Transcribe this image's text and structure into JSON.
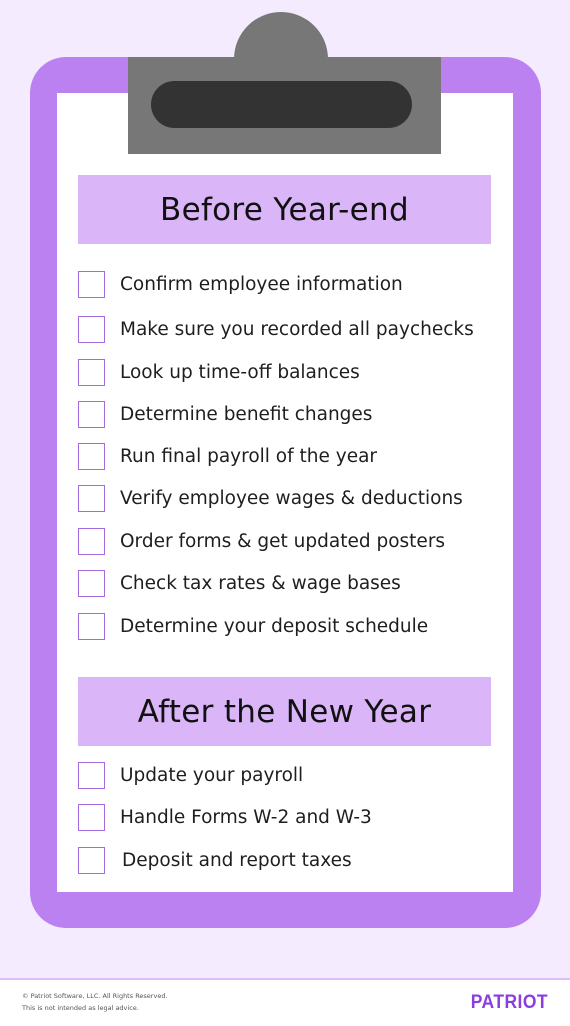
{
  "colors": {
    "background": "#f5ebfe",
    "clipboard_frame": "#bb81f0",
    "clip_plate": "#777777",
    "clip_slot": "#333333",
    "header_fill": "#dab5f8",
    "checkbox_border": "#a46be0",
    "brand": "#8a3ee0"
  },
  "sections": [
    {
      "title": "Before Year-end",
      "items": [
        {
          "label": "Confirm employee information",
          "checked": false
        },
        {
          "label": "Make sure you recorded all paychecks",
          "checked": false
        },
        {
          "label": "Look up time-off balances",
          "checked": false
        },
        {
          "label": "Determine benefit changes",
          "checked": false
        },
        {
          "label": "Run final payroll of the year",
          "checked": false
        },
        {
          "label": "Verify employee wages & deductions",
          "checked": false
        },
        {
          "label": "Order forms & get updated posters",
          "checked": false
        },
        {
          "label": "Check tax rates & wage bases",
          "checked": false
        },
        {
          "label": "Determine your deposit schedule",
          "checked": false
        }
      ]
    },
    {
      "title": "After the New Year",
      "items": [
        {
          "label": "Update your payroll",
          "checked": false
        },
        {
          "label": "Handle Forms W-2 and W-3",
          "checked": false
        },
        {
          "label": "Deposit and report taxes",
          "checked": false
        }
      ]
    }
  ],
  "footer": {
    "copyright": "© Patriot Software, LLC. All Rights Reserved.",
    "disclaimer": "This is not intended as legal advice.",
    "logo": "PATRIOT"
  }
}
